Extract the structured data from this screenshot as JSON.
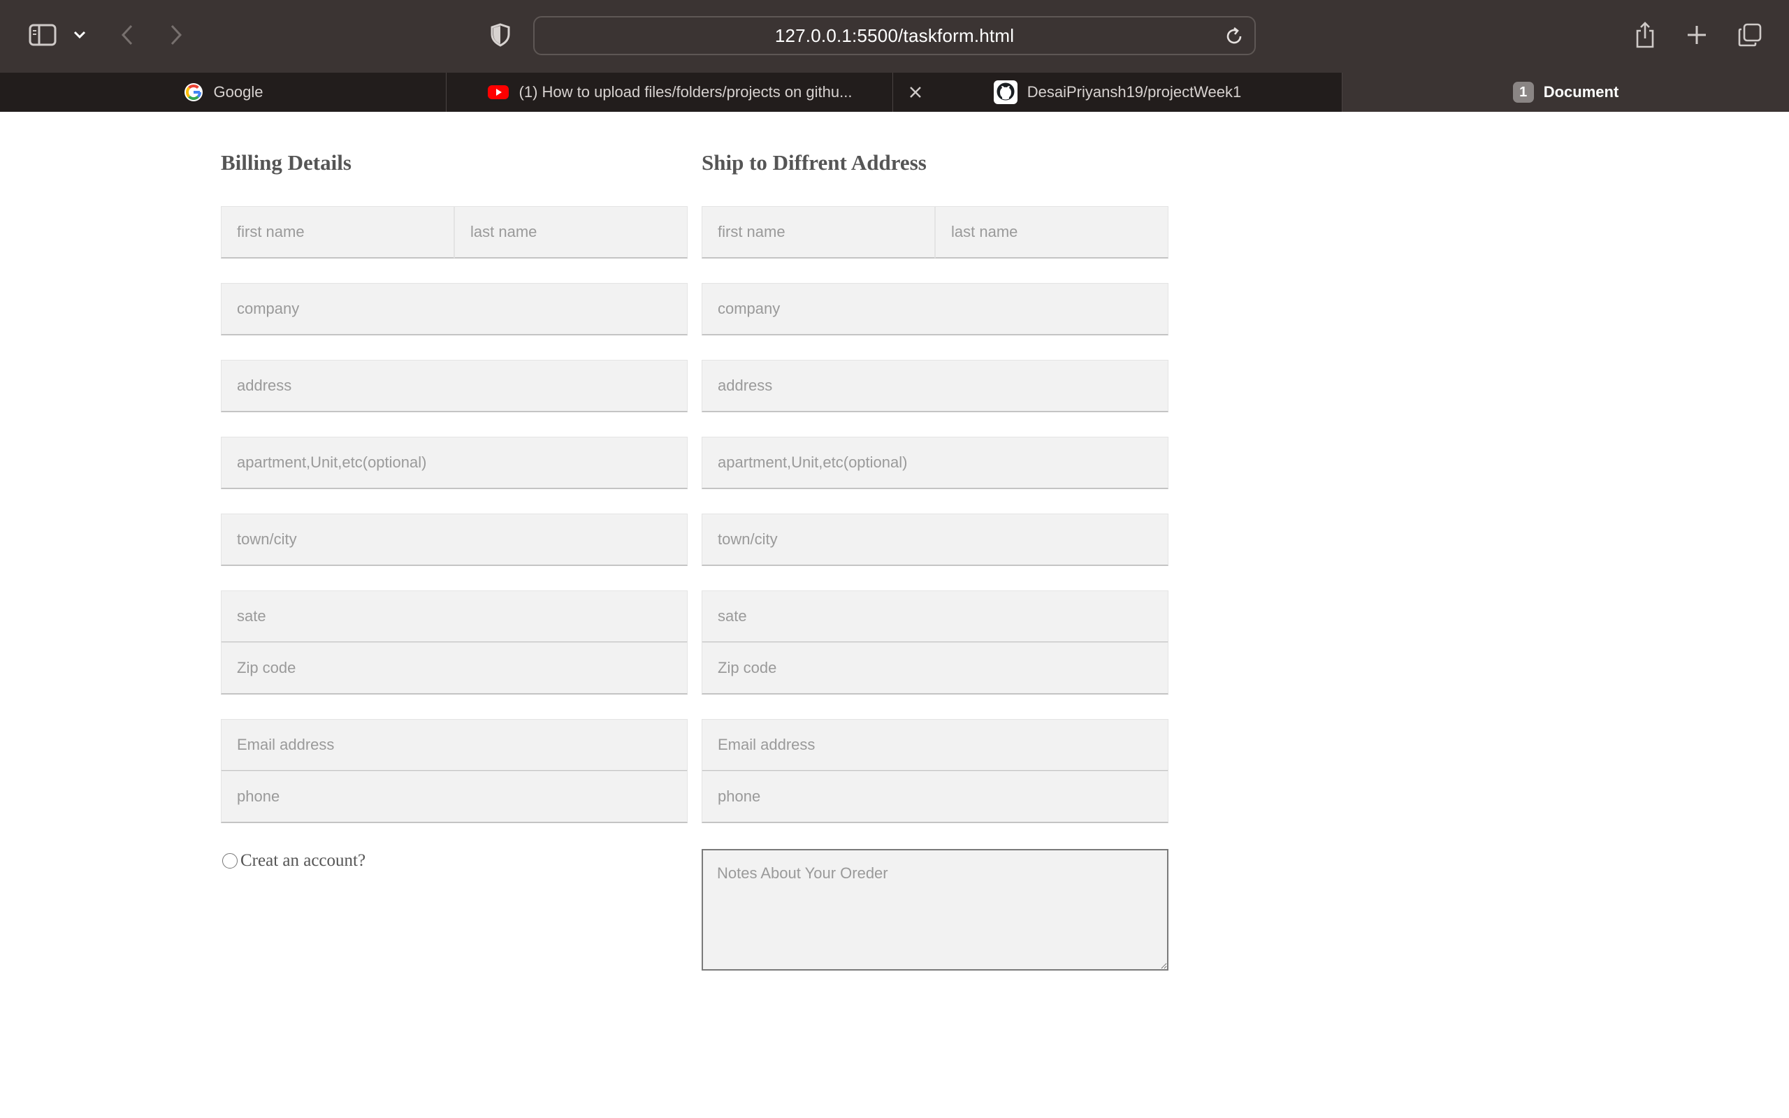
{
  "browser": {
    "url": "127.0.0.1:5500/taskform.html",
    "icons": {
      "sidebar": "sidebar-icon",
      "chevron": "chevron-down-icon",
      "back": "back-arrow-icon",
      "forward": "forward-arrow-icon",
      "privacy": "shield-icon",
      "reload": "reload-icon",
      "share": "share-icon",
      "new_tab": "plus-icon",
      "tab_overview": "tab-overview-icon"
    },
    "tabs": [
      {
        "title": "Google",
        "favicon": "google-favicon"
      },
      {
        "title": "(1) How to upload files/folders/projects on githu...",
        "favicon": "youtube-favicon"
      },
      {
        "title": "DesaiPriyansh19/projectWeek1",
        "favicon": "github-favicon"
      },
      {
        "title": "Document",
        "badge": "1",
        "active": true
      }
    ]
  },
  "billing": {
    "title": "Billing Details",
    "first_name": "first name",
    "last_name": "last name",
    "company": "company",
    "address": "address",
    "apartment": "apartment,Unit,etc(optional)",
    "town": "town/city",
    "state": "sate",
    "zip": "Zip code",
    "email": "Email address",
    "phone": "phone",
    "create_account": "Creat an account?"
  },
  "shipping": {
    "title": "Ship to Diffrent Address",
    "first_name": "first name",
    "last_name": "last name",
    "company": "company",
    "address": "address",
    "apartment": "apartment,Unit,etc(optional)",
    "town": "town/city",
    "state": "sate",
    "zip": "Zip code",
    "email": "Email address",
    "phone": "phone",
    "notes": "Notes About Your Oreder"
  },
  "colors": {
    "toolbar": "#3b3433",
    "tabstrip": "#221d1c",
    "field_bg": "#f2f2f2",
    "heading": "#555555"
  }
}
